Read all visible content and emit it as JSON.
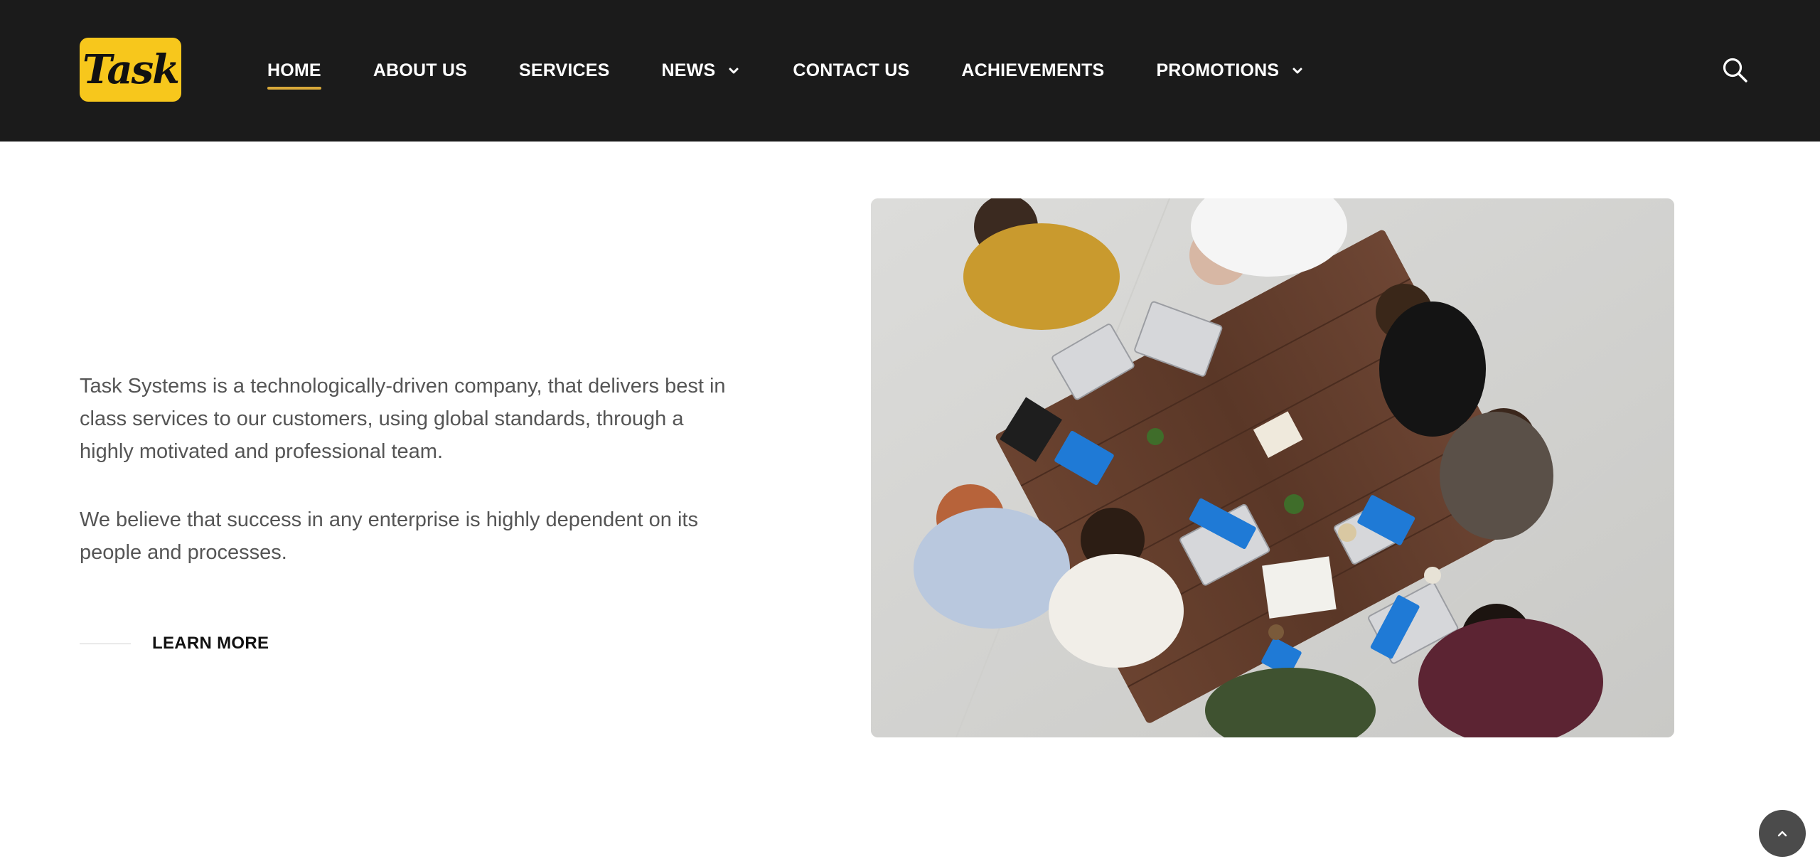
{
  "brand": {
    "logo_text": "Task",
    "accent": "#f7c71c",
    "underline": "#d8a93a"
  },
  "nav": {
    "items": [
      {
        "label": "HOME",
        "active": true
      },
      {
        "label": "ABOUT US"
      },
      {
        "label": "SERVICES"
      },
      {
        "label": "NEWS",
        "dropdown": true
      },
      {
        "label": "CONTACT US"
      },
      {
        "label": "ACHIEVEMENTS"
      },
      {
        "label": "PROMOTIONS",
        "dropdown": true
      }
    ],
    "search_icon": "search-icon"
  },
  "main": {
    "paragraph_1": "Task Systems is a technologically-driven company, that delivers best in class services to our customers, using global standards, through a highly motivated and professional team.",
    "paragraph_2": "We believe that success in any enterprise is highly dependent on its people and processes.",
    "learn_more_label": "LEARN MORE"
  },
  "hero": {
    "image_icon": "team-meeting-photo"
  },
  "back_to_top_icon": "chevron-up-icon"
}
